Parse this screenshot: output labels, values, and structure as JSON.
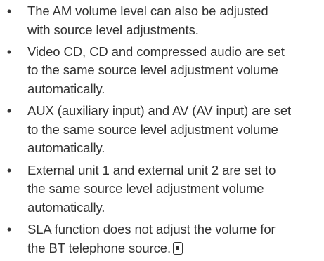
{
  "notes": [
    {
      "lines": [
        "The AM volume level can also be adjusted",
        "with source level adjustments."
      ]
    },
    {
      "lines": [
        "Video CD, CD and compressed audio are set",
        "to the same source level adjustment volume",
        "automatically."
      ]
    },
    {
      "lines": [
        "AUX (auxiliary input) and AV (AV input) are set",
        "to the same source level adjustment volume",
        "automatically."
      ]
    },
    {
      "lines": [
        "External unit 1 and external unit 2 are set to",
        "the same source level adjustment volume",
        "automatically."
      ]
    },
    {
      "lines": [
        "SLA function does not adjust the volume for",
        "the BT telephone source."
      ]
    }
  ],
  "bullet_glyph": "•",
  "colors": {
    "text": "#333333",
    "background": "#ffffff"
  },
  "end_mark_icon": "section-end-icon"
}
